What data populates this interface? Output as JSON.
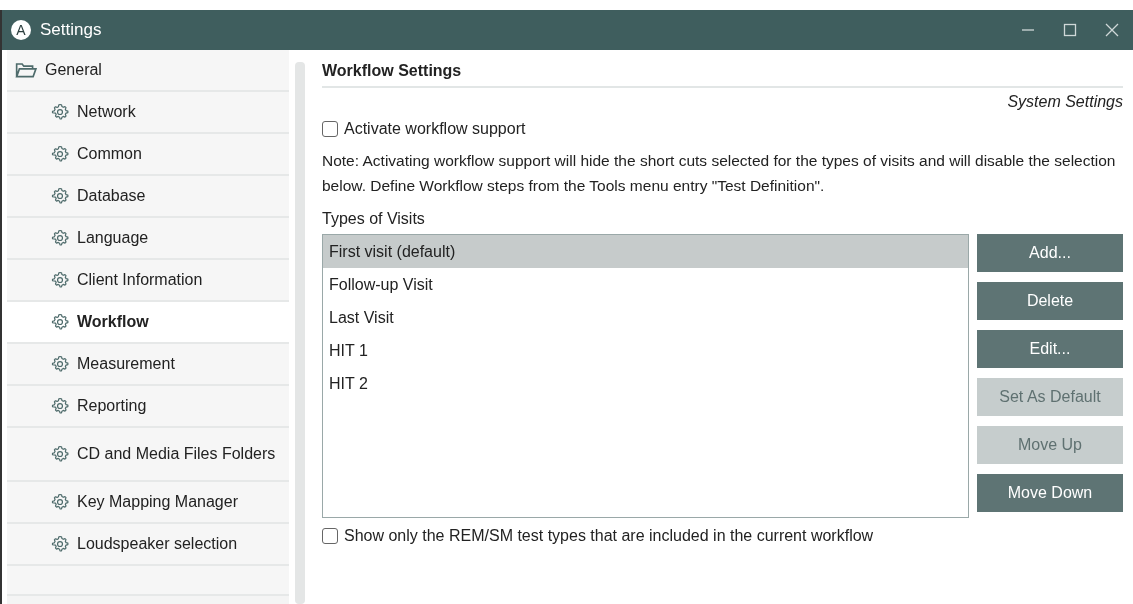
{
  "window": {
    "logo": "A",
    "title": "Settings"
  },
  "sidebar": {
    "items": [
      {
        "label": "General",
        "kind": "folder",
        "selected": false,
        "expanded": true,
        "children": [
          {
            "label": "Network",
            "kind": "setting",
            "selected": false
          },
          {
            "label": "Common",
            "kind": "setting",
            "selected": false
          },
          {
            "label": "Database",
            "kind": "setting",
            "selected": false
          },
          {
            "label": "Language",
            "kind": "setting",
            "selected": false
          },
          {
            "label": "Client Information",
            "kind": "setting",
            "selected": false
          },
          {
            "label": "Workflow",
            "kind": "setting",
            "selected": true
          },
          {
            "label": "Measurement",
            "kind": "setting",
            "selected": false
          },
          {
            "label": "Reporting",
            "kind": "setting",
            "selected": false
          },
          {
            "label": "CD and Media Files Folders",
            "kind": "setting",
            "selected": false
          },
          {
            "label": "Key Mapping Manager",
            "kind": "setting",
            "selected": false
          },
          {
            "label": "Loudspeaker selection",
            "kind": "setting",
            "selected": false
          }
        ]
      }
    ]
  },
  "content": {
    "heading": "Workflow Settings",
    "scope": "System Settings",
    "activate": {
      "label": "Activate workflow support",
      "checked": false
    },
    "note": "Note: Activating workflow support will hide the short cuts selected for the types of visits and will disable the selection below. Define Workflow steps from the Tools menu entry \"Test Definition\".",
    "visits_label": "Types of Visits",
    "visits": [
      {
        "label": "First visit (default)",
        "selected": true
      },
      {
        "label": "Follow-up Visit",
        "selected": false
      },
      {
        "label": "Last Visit",
        "selected": false
      },
      {
        "label": "HIT 1",
        "selected": false
      },
      {
        "label": "HIT 2",
        "selected": false
      }
    ],
    "buttons": [
      {
        "label": "Add...",
        "disabled": false
      },
      {
        "label": "Delete",
        "disabled": false
      },
      {
        "label": "Edit...",
        "disabled": false
      },
      {
        "label": "Set As Default",
        "disabled": true
      },
      {
        "label": "Move Up",
        "disabled": true
      },
      {
        "label": "Move Down",
        "disabled": false
      }
    ],
    "filter": {
      "label": "Show only the REM/SM test types that are included in the current workflow",
      "checked": false
    }
  }
}
